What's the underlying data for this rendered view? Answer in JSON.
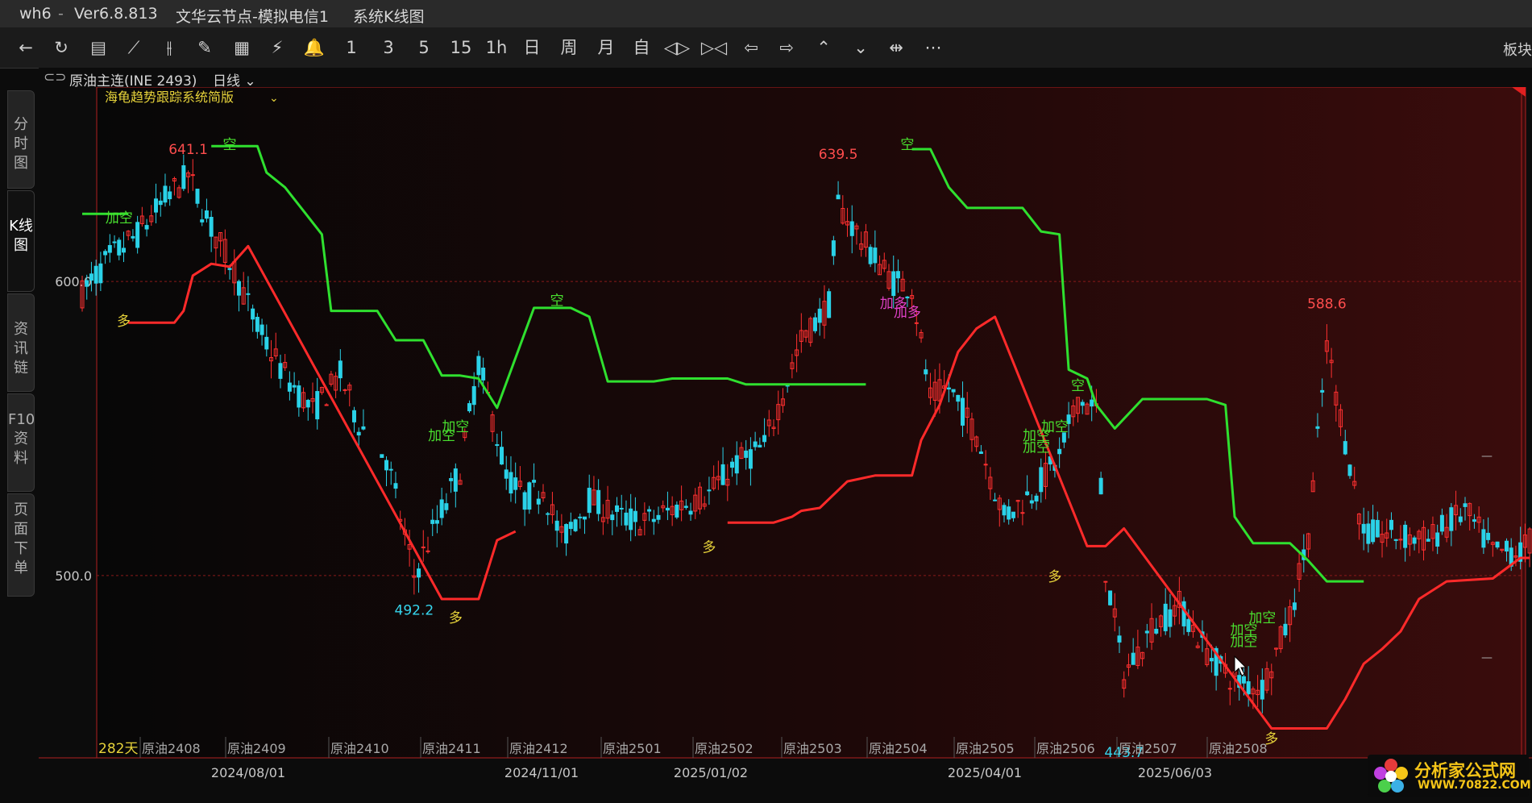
{
  "window": {
    "app": "wh6",
    "version": "Ver6.8.813",
    "server": "文华云节点-模拟电信1",
    "view": "系统K线图"
  },
  "toolbar": {
    "period_buttons": [
      "1",
      "3",
      "5",
      "15",
      "1h",
      "日",
      "周",
      "月",
      "自"
    ],
    "right_label": "板块"
  },
  "sidebar": {
    "tabs": [
      "分时图",
      "K线图",
      "资讯链",
      "F10资料",
      "页面下单"
    ]
  },
  "header": {
    "contract": "原油主连(INE 2493)",
    "period": "日线",
    "indicator": "海龟趋势跟踪系统简版"
  },
  "chart_data": {
    "type": "candlestick",
    "ylim": [
      438,
      665
    ],
    "y_ticks": [
      600.0,
      500.0
    ],
    "y_tick_labels": [
      "600.0",
      "500.0"
    ],
    "bar_count_label": "282天",
    "contract_labels": [
      "原油2408",
      "原油2409",
      "原油2410",
      "原油2411",
      "原油2412",
      "原油2501",
      "原油2502",
      "原油2503",
      "原油2504",
      "原油2505",
      "原油2506",
      "原油2507",
      "原油2508"
    ],
    "date_labels": [
      "2024/08/01",
      "2024/11/01",
      "2025/01/02",
      "2025/04/01",
      "2025/06/03"
    ],
    "price_marks": [
      {
        "label": "641.1",
        "bar": 23,
        "price": 641.1,
        "side": "high"
      },
      {
        "label": "492.2",
        "bar": 72,
        "price": 492.2,
        "side": "low"
      },
      {
        "label": "639.5",
        "bar": 164,
        "price": 639.5,
        "side": "high"
      },
      {
        "label": "588.6",
        "bar": 270,
        "price": 588.6,
        "side": "high"
      },
      {
        "label": "443.7",
        "bar": 226,
        "price": 443.7,
        "side": "low"
      }
    ],
    "signals": [
      {
        "text": "加空",
        "bar": 8,
        "price": 620,
        "color": "#49e02f"
      },
      {
        "text": "空",
        "bar": 32,
        "price": 645,
        "color": "#49e02f"
      },
      {
        "text": "多",
        "bar": 9,
        "price": 585,
        "color": "#e6d23a"
      },
      {
        "text": "加空",
        "bar": 78,
        "price": 546,
        "color": "#49e02f"
      },
      {
        "text": "加空",
        "bar": 81,
        "price": 549,
        "color": "#49e02f"
      },
      {
        "text": "空",
        "bar": 103,
        "price": 592,
        "color": "#49e02f"
      },
      {
        "text": "多",
        "bar": 81,
        "price": 484,
        "color": "#e6d23a"
      },
      {
        "text": "多",
        "bar": 136,
        "price": 508,
        "color": "#e6d23a"
      },
      {
        "text": "空",
        "bar": 179,
        "price": 645,
        "color": "#49e02f"
      },
      {
        "text": "加多",
        "bar": 176,
        "price": 591,
        "color": "#e040c8"
      },
      {
        "text": "加多",
        "bar": 179,
        "price": 588,
        "color": "#e040c8"
      },
      {
        "text": "加空",
        "bar": 211,
        "price": 549,
        "color": "#49e02f"
      },
      {
        "text": "加空",
        "bar": 207,
        "price": 546,
        "color": "#49e02f"
      },
      {
        "text": "加空",
        "bar": 207,
        "price": 542,
        "color": "#49e02f"
      },
      {
        "text": "空",
        "bar": 216,
        "price": 563,
        "color": "#49e02f"
      },
      {
        "text": "多",
        "bar": 211,
        "price": 498,
        "color": "#e6d23a"
      },
      {
        "text": "加空",
        "bar": 256,
        "price": 484,
        "color": "#49e02f"
      },
      {
        "text": "加空",
        "bar": 252,
        "price": 480,
        "color": "#49e02f"
      },
      {
        "text": "加空",
        "bar": 252,
        "price": 476,
        "color": "#49e02f"
      },
      {
        "text": "多",
        "bar": 258,
        "price": 443,
        "color": "#e6d23a"
      }
    ],
    "short_stop": [
      [
        0,
        623
      ],
      [
        10,
        623
      ],
      [
        22,
        null
      ],
      [
        28,
        646
      ],
      [
        38,
        646
      ],
      [
        40,
        637
      ],
      [
        44,
        632
      ],
      [
        48,
        624
      ],
      [
        52,
        616
      ],
      [
        54,
        590
      ],
      [
        58,
        590
      ],
      [
        64,
        590
      ],
      [
        68,
        580
      ],
      [
        74,
        580
      ],
      [
        78,
        568
      ],
      [
        82,
        568
      ],
      [
        86,
        567
      ],
      [
        90,
        557
      ],
      [
        98,
        591
      ],
      [
        106,
        591
      ],
      [
        110,
        588
      ],
      [
        114,
        566
      ],
      [
        118,
        566
      ],
      [
        124,
        566
      ],
      [
        128,
        567
      ],
      [
        140,
        567
      ],
      [
        144,
        565
      ],
      [
        150,
        565
      ],
      [
        170,
        565
      ],
      [
        176,
        null
      ],
      [
        180,
        645
      ],
      [
        184,
        645
      ],
      [
        188,
        632
      ],
      [
        192,
        625
      ],
      [
        198,
        625
      ],
      [
        204,
        625
      ],
      [
        208,
        617
      ],
      [
        212,
        616
      ],
      [
        214,
        570
      ],
      [
        218,
        567
      ],
      [
        220,
        558
      ],
      [
        224,
        550
      ],
      [
        230,
        560
      ],
      [
        244,
        560
      ],
      [
        248,
        558
      ],
      [
        250,
        520
      ],
      [
        254,
        511
      ],
      [
        262,
        511
      ],
      [
        266,
        505
      ],
      [
        270,
        498
      ],
      [
        278,
        498
      ]
    ],
    "long_stop": [
      [
        10,
        586
      ],
      [
        20,
        586
      ],
      [
        22,
        590
      ],
      [
        24,
        602
      ],
      [
        28,
        606
      ],
      [
        32,
        605
      ],
      [
        36,
        612
      ],
      [
        78,
        492
      ],
      [
        86,
        492
      ],
      [
        88,
        502
      ],
      [
        90,
        512
      ],
      [
        94,
        515
      ],
      [
        98,
        null
      ],
      [
        140,
        518
      ],
      [
        150,
        518
      ],
      [
        154,
        520
      ],
      [
        156,
        522
      ],
      [
        160,
        523
      ],
      [
        166,
        532
      ],
      [
        172,
        534
      ],
      [
        180,
        534
      ],
      [
        182,
        546
      ],
      [
        186,
        558
      ],
      [
        190,
        576
      ],
      [
        194,
        584
      ],
      [
        196,
        586
      ],
      [
        198,
        588
      ],
      [
        218,
        510
      ],
      [
        222,
        510
      ],
      [
        224,
        513
      ],
      [
        226,
        516
      ],
      [
        258,
        448
      ],
      [
        270,
        448
      ],
      [
        274,
        458
      ],
      [
        278,
        470
      ],
      [
        282,
        475
      ],
      [
        286,
        481
      ],
      [
        290,
        492
      ],
      [
        296,
        498
      ],
      [
        306,
        499
      ],
      [
        312,
        506
      ],
      [
        314,
        506
      ]
    ]
  },
  "logo": {
    "title": "分析家公式网",
    "url": "WWW.70822.COM"
  }
}
